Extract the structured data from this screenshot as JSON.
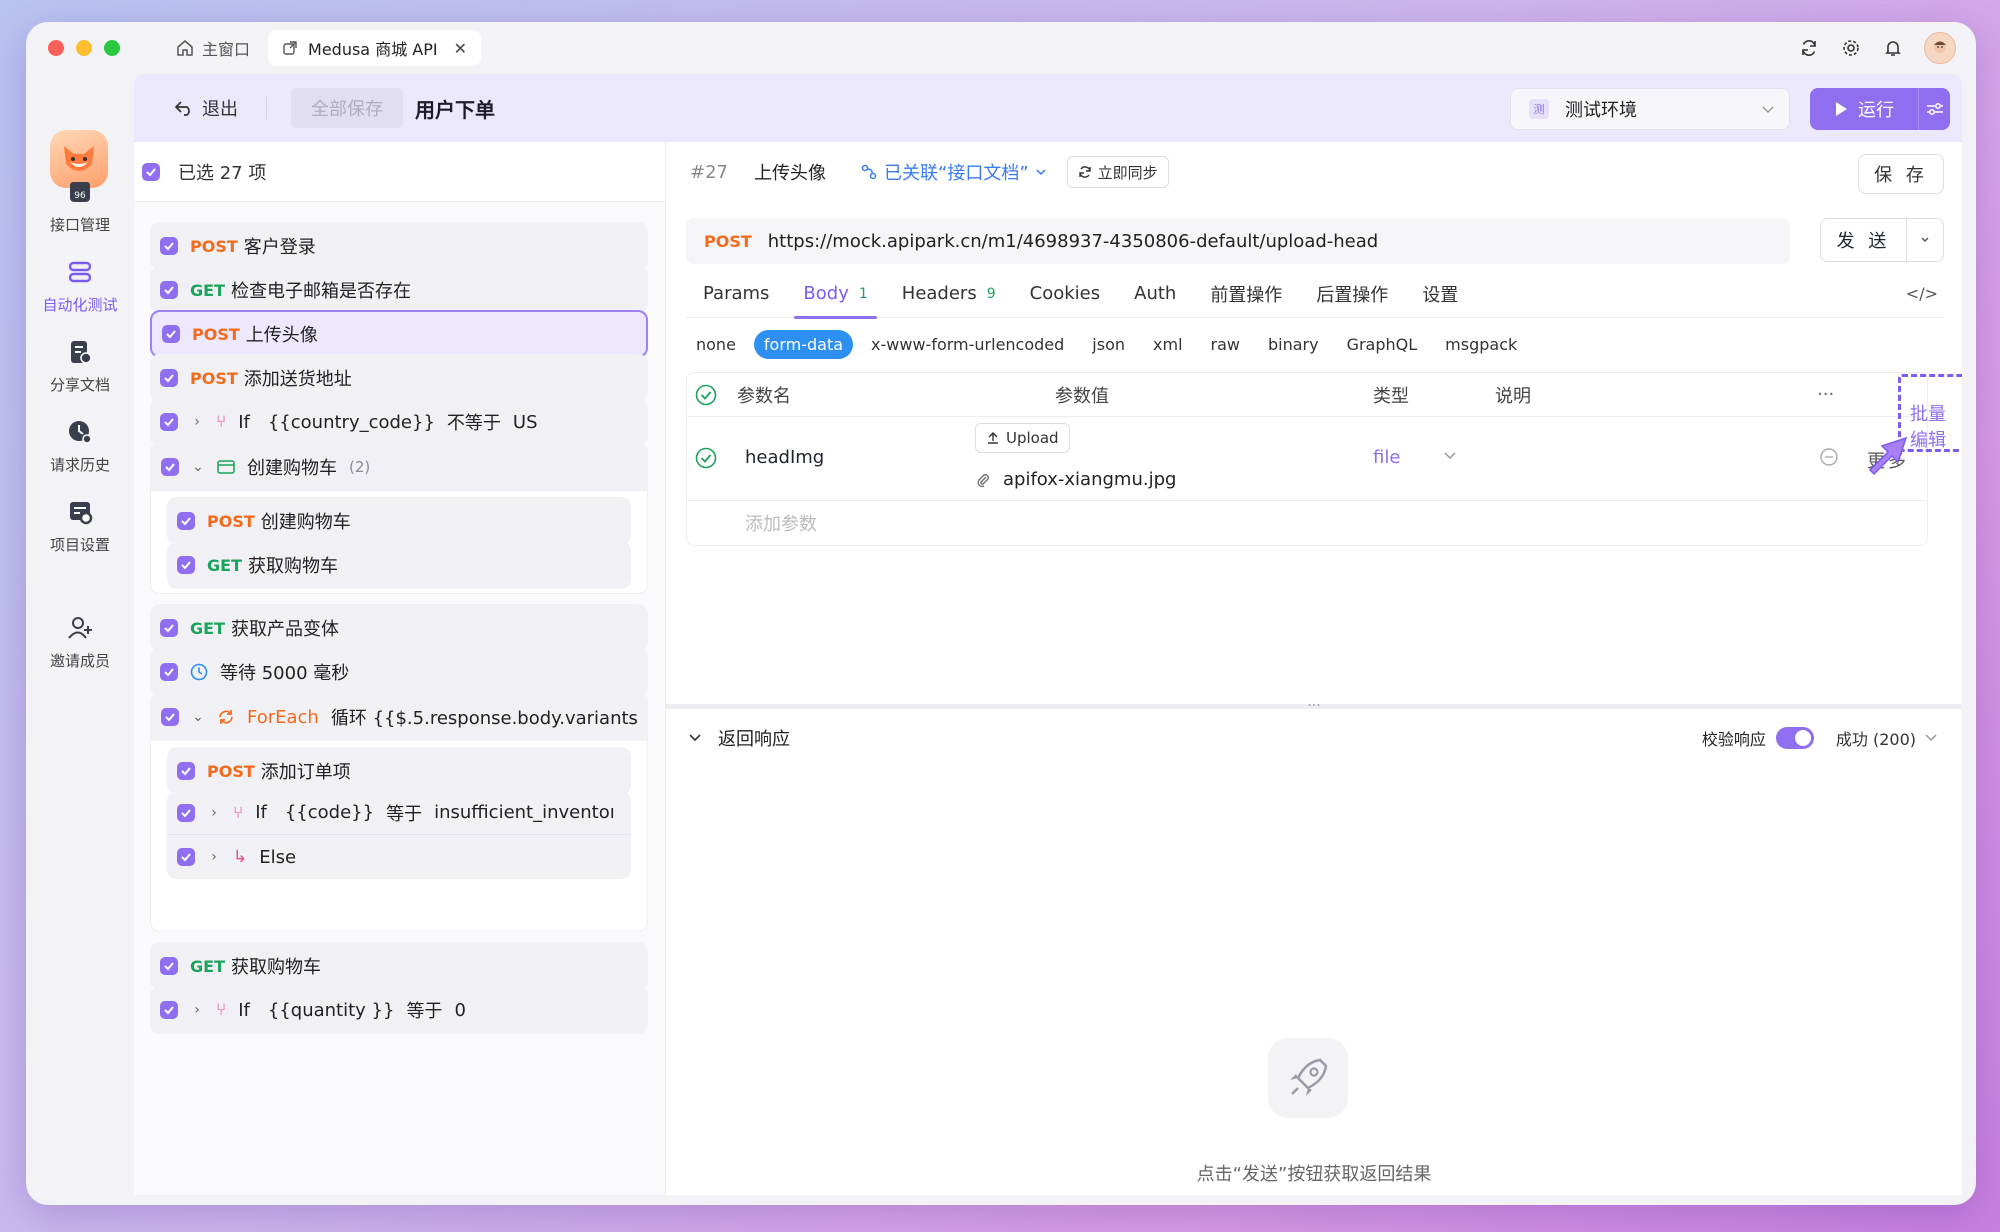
{
  "titlebar": {
    "home_tab": "主窗口",
    "active_tab": "Medusa 商城 API"
  },
  "sidebar": {
    "items": [
      {
        "label": "接口管理",
        "icon": "api-icon"
      },
      {
        "label": "自动化测试",
        "icon": "automation-icon",
        "active": true
      },
      {
        "label": "分享文档",
        "icon": "share-doc-icon"
      },
      {
        "label": "请求历史",
        "icon": "history-icon"
      },
      {
        "label": "项目设置",
        "icon": "project-settings-icon"
      },
      {
        "label": "邀请成员",
        "icon": "invite-icon"
      }
    ]
  },
  "toolbar": {
    "exit_label": "退出",
    "save_all_label": "全部保存",
    "title": "用户下单",
    "env_badge": "测",
    "env_label": "测试环境",
    "run_label": "运行"
  },
  "list": {
    "selected_label": "已选 27 项",
    "rows": [
      {
        "method": "POST",
        "name": "客户登录"
      },
      {
        "method": "GET",
        "name": "检查电子邮箱是否存在"
      },
      {
        "method": "POST",
        "name": "上传头像"
      },
      {
        "method": "POST",
        "name": "添加送货地址"
      }
    ],
    "if1": {
      "keyword": "If",
      "left": "{{country_code}}",
      "op": "不等于",
      "right": "US"
    },
    "group1": {
      "name": "创建购物车",
      "count": "(2)",
      "items": [
        {
          "method": "POST",
          "name": "创建购物车"
        },
        {
          "method": "GET",
          "name": "获取购物车"
        }
      ]
    },
    "row_variants": {
      "method": "GET",
      "name": "获取产品变体"
    },
    "wait": {
      "label": "等待 5000 毫秒"
    },
    "foreach": {
      "keyword": "ForEach",
      "expr": "循环 {{$.5.response.body.variants",
      "items": [
        {
          "method": "POST",
          "name": "添加订单项"
        }
      ],
      "if": {
        "keyword": "If",
        "left": "{{code}}",
        "op": "等于",
        "right": "insufficient_inventoı"
      },
      "else": "Else"
    },
    "row_cart": {
      "method": "GET",
      "name": "获取购物车"
    },
    "if3": {
      "keyword": "If",
      "left": "{{quantity }}",
      "op": "等于",
      "right": "0"
    }
  },
  "detail": {
    "hash": "#",
    "id": "27",
    "title": "上传头像",
    "linked_label": "已关联“接口文档”",
    "sync_label": "立即同步",
    "save_label": "保 存",
    "method": "POST",
    "url": "https://mock.apipark.cn/m1/4698937-4350806-default/upload-head",
    "send_label": "发 送",
    "tabs": [
      {
        "label": "Params"
      },
      {
        "label": "Body",
        "count": "1",
        "active": true
      },
      {
        "label": "Headers",
        "count": "9"
      },
      {
        "label": "Cookies"
      },
      {
        "label": "Auth"
      },
      {
        "label": "前置操作"
      },
      {
        "label": "后置操作"
      },
      {
        "label": "设置"
      }
    ],
    "body_types": [
      "none",
      "form-data",
      "x-www-form-urlencoded",
      "json",
      "xml",
      "raw",
      "binary",
      "GraphQL",
      "msgpack"
    ],
    "body_type_active": "form-data",
    "table": {
      "col_name": "参数名",
      "col_value": "参数值",
      "col_type": "类型",
      "col_desc": "说明",
      "bulk_edit": "批量编辑",
      "more_dots": "···",
      "param": {
        "name": "headImg",
        "upload_label": "Upload",
        "filename": "apifox-xiangmu.jpg",
        "type": "file",
        "more": "更多"
      },
      "add_placeholder": "添加参数"
    },
    "response": {
      "title": "返回响应",
      "validate_label": "校验响应",
      "status": "成功 (200)",
      "empty_text": "点击“发送”按钮获取返回结果"
    }
  },
  "colors": {
    "accent": "#8f6ef0",
    "post": "#f26b1d",
    "get": "#1aa35c",
    "link": "#3a7bf0"
  }
}
